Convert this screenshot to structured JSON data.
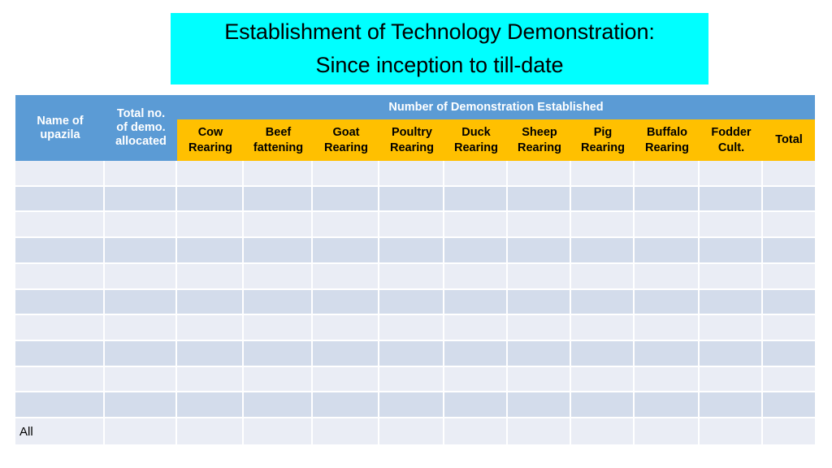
{
  "slide": {
    "background_color": "#FFFFFF"
  },
  "title": {
    "background_color": "#00FFFF",
    "line1": "Establishment of Technology Demonstration:",
    "line2": "Since inception to till-date"
  },
  "table": {
    "header_blue_color": "#5B9BD5",
    "header_amber_color": "#FFC000",
    "row_light_color": "#EAEDF5",
    "row_dark_color": "#D3DCEB",
    "corner_headers": [
      "Name of upazila",
      "Total no. of demo. allocated"
    ],
    "corner_headers_lines": [
      [
        "Name of",
        "upazila"
      ],
      [
        "Total no.",
        "of demo.",
        "allocated"
      ]
    ],
    "group_header": "Number of Demonstration Established",
    "sub_headers": [
      "Cow Rearing",
      "Beef fattening",
      "Goat Rearing",
      "Poultry Rearing",
      "Duck Rearing",
      "Sheep Rearing",
      "Pig Rearing",
      "Buffalo Rearing",
      "Fodder Cult.",
      "Total"
    ],
    "sub_headers_lines": [
      [
        "Cow",
        "Rearing"
      ],
      [
        "Beef",
        "fattening"
      ],
      [
        "Goat",
        "Rearing"
      ],
      [
        "Poultry",
        "Rearing"
      ],
      [
        "Duck",
        "Rearing"
      ],
      [
        "Sheep",
        "Rearing"
      ],
      [
        "Pig",
        "Rearing"
      ],
      [
        "Buffalo",
        "Rearing"
      ],
      [
        "Fodder",
        "Cult."
      ],
      [
        "Total"
      ]
    ],
    "rows": [
      [
        "",
        "",
        "",
        "",
        "",
        "",
        "",
        "",
        "",
        "",
        "",
        ""
      ],
      [
        "",
        "",
        "",
        "",
        "",
        "",
        "",
        "",
        "",
        "",
        "",
        ""
      ],
      [
        "",
        "",
        "",
        "",
        "",
        "",
        "",
        "",
        "",
        "",
        "",
        ""
      ],
      [
        "",
        "",
        "",
        "",
        "",
        "",
        "",
        "",
        "",
        "",
        "",
        ""
      ],
      [
        "",
        "",
        "",
        "",
        "",
        "",
        "",
        "",
        "",
        "",
        "",
        ""
      ],
      [
        "",
        "",
        "",
        "",
        "",
        "",
        "",
        "",
        "",
        "",
        "",
        ""
      ],
      [
        "",
        "",
        "",
        "",
        "",
        "",
        "",
        "",
        "",
        "",
        "",
        ""
      ],
      [
        "",
        "",
        "",
        "",
        "",
        "",
        "",
        "",
        "",
        "",
        "",
        ""
      ],
      [
        "",
        "",
        "",
        "",
        "",
        "",
        "",
        "",
        "",
        "",
        "",
        ""
      ],
      [
        "",
        "",
        "",
        "",
        "",
        "",
        "",
        "",
        "",
        "",
        "",
        ""
      ],
      [
        "All",
        "",
        "",
        "",
        "",
        "",
        "",
        "",
        "",
        "",
        "",
        ""
      ]
    ]
  }
}
